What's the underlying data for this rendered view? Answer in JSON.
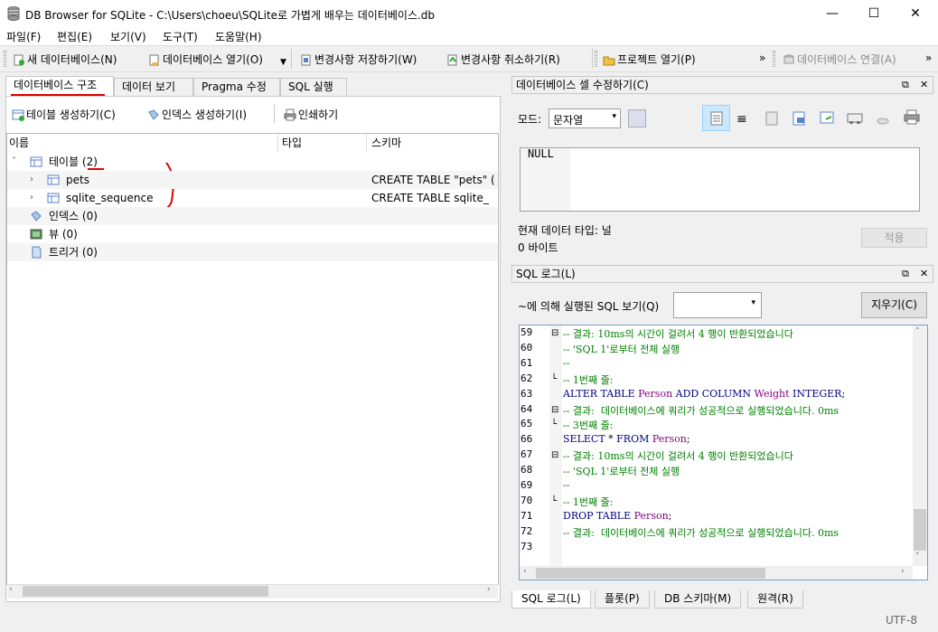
{
  "window": {
    "title": "DB Browser for SQLite - C:\\Users\\choeu\\SQLite로 가볍게 배우는 데이터베이스.db",
    "minimize": "—",
    "maximize": "☐",
    "close": "✕"
  },
  "menu": [
    "파일(F)",
    "편집(E)",
    "보기(V)",
    "도구(T)",
    "도움말(H)"
  ],
  "toolbar": {
    "new_db": "새 데이터베이스(N)",
    "open_db": "데이터베이스 열기(O)",
    "write_changes": "변경사항 저장하기(W)",
    "revert_changes": "변경사항 취소하기(R)",
    "open_project": "프로젝트 열기(P)",
    "more1": "»",
    "attach_db": "데이터베이스 연결(A)",
    "more2": "»"
  },
  "left_tabs": [
    "데이터베이스 구조",
    "데이터 보기",
    "Pragma 수정",
    "SQL 실행"
  ],
  "structure_toolbar": {
    "create_table": "테이블 생성하기(C)",
    "create_index": "인덱스 생성하기(I)",
    "print": "인쇄하기"
  },
  "tree": {
    "headers": [
      "이름",
      "타입",
      "스키마"
    ],
    "rows": [
      {
        "name": "테이블 (2)",
        "type": "",
        "schema": "",
        "expander": "˅"
      },
      {
        "name": "pets",
        "type": "",
        "schema": "CREATE TABLE \"pets\" (",
        "expander": "›"
      },
      {
        "name": "sqlite_sequence",
        "type": "",
        "schema": "CREATE TABLE sqlite_",
        "expander": "›"
      },
      {
        "name": "인덱스 (0)",
        "type": "",
        "schema": ""
      },
      {
        "name": "뷰 (0)",
        "type": "",
        "schema": ""
      },
      {
        "name": "트리거 (0)",
        "type": "",
        "schema": ""
      }
    ]
  },
  "cell_editor": {
    "title": "데이터베이스 셀 수정하기(C)",
    "mode_label": "모드:",
    "mode_value": "문자열",
    "value": "NULL",
    "type_label": "현재 데이터 타입: 널",
    "size_label": "0 바이트",
    "apply": "적용",
    "float_icon": "⧉",
    "close_icon": "✕"
  },
  "sql_log": {
    "title": "SQL 로그(L)",
    "filter_label": "~에 의해 실행된 SQL 보기(Q)",
    "filter_value": "",
    "clear": "지우기(C)",
    "lines": [
      {
        "n": "59",
        "fold": "⊟",
        "text": "-- 결과: 10ms의 시간이 걸려서 4 행이 반환되었습니다",
        "kind": "cm"
      },
      {
        "n": "60",
        "fold": "",
        "text": "-- 'SQL 1'로부터 전체 실행",
        "kind": "cm"
      },
      {
        "n": "61",
        "fold": "",
        "text": "--",
        "kind": "cm"
      },
      {
        "n": "62",
        "fold": "└",
        "text": "-- 1번째 줄:",
        "kind": "cm"
      },
      {
        "n": "63",
        "fold": "",
        "text": "ALTER TABLE Person ADD COLUMN Weight INTEGER;",
        "kind": "sql1"
      },
      {
        "n": "64",
        "fold": "⊟",
        "text": "-- 결과:  데이터베이스에 쿼리가 성공적으로 실행되었습니다. 0ms",
        "kind": "cm"
      },
      {
        "n": "65",
        "fold": "└",
        "text": "-- 3번째 줄:",
        "kind": "cm"
      },
      {
        "n": "66",
        "fold": "",
        "text": "SELECT * FROM Person;",
        "kind": "sql2"
      },
      {
        "n": "67",
        "fold": "⊟",
        "text": "-- 결과: 10ms의 시간이 걸려서 4 행이 반환되었습니다",
        "kind": "cm"
      },
      {
        "n": "68",
        "fold": "",
        "text": "-- 'SQL 1'로부터 전체 실행",
        "kind": "cm"
      },
      {
        "n": "69",
        "fold": "",
        "text": "--",
        "kind": "cm"
      },
      {
        "n": "70",
        "fold": "└",
        "text": "-- 1번째 줄:",
        "kind": "cm"
      },
      {
        "n": "71",
        "fold": "",
        "text": "DROP TABLE Person;",
        "kind": "sql3"
      },
      {
        "n": "72",
        "fold": "",
        "text": "-- 결과:  데이터베이스에 쿼리가 성공적으로 실행되었습니다. 0ms",
        "kind": "cm"
      },
      {
        "n": "73",
        "fold": "",
        "text": "",
        "kind": "cm"
      }
    ]
  },
  "bottom_tabs": [
    "SQL 로그(L)",
    "플롯(P)",
    "DB 스키마(M)",
    "원격(R)"
  ],
  "status": {
    "encoding": "UTF-8"
  },
  "colors": {
    "accent": "#cce8ff",
    "annotation": "#e00000",
    "comment": "#008000",
    "keyword": "#00007f",
    "identifier": "#7f007f"
  }
}
